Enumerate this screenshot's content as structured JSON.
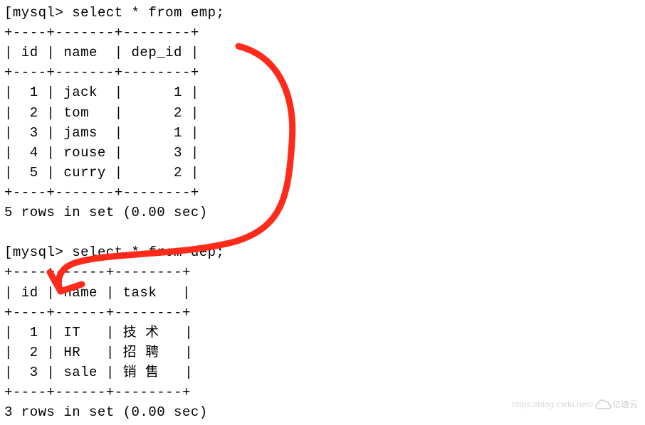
{
  "prompt": "mysql>",
  "query1": {
    "command": "select * from emp;",
    "border_top": "+----+-------+--------+",
    "header_row": "| id | name  | dep_id |",
    "border_mid": "+----+-------+--------+",
    "columns": [
      "id",
      "name",
      "dep_id"
    ],
    "rows": [
      {
        "line": "|  1 | jack  |      1 |",
        "id": 1,
        "name": "jack",
        "dep_id": 1
      },
      {
        "line": "|  2 | tom   |      2 |",
        "id": 2,
        "name": "tom",
        "dep_id": 2
      },
      {
        "line": "|  3 | jams  |      1 |",
        "id": 3,
        "name": "jams",
        "dep_id": 1
      },
      {
        "line": "|  4 | rouse |      3 |",
        "id": 4,
        "name": "rouse",
        "dep_id": 3
      },
      {
        "line": "|  5 | curry |      2 |",
        "id": 5,
        "name": "curry",
        "dep_id": 2
      }
    ],
    "border_bot": "+----+-------+--------+",
    "status": "5 rows in set (0.00 sec)"
  },
  "query2": {
    "command": "select * from dep;",
    "border_top": "+----+------+--------+",
    "header_row": "| id | name | task   |",
    "border_mid": "+----+------+--------+",
    "columns": [
      "id",
      "name",
      "task"
    ],
    "rows": [
      {
        "line": "|  1 | IT   | 技 术   |",
        "id": 1,
        "name": "IT",
        "task": "技术"
      },
      {
        "line": "|  2 | HR   | 招 聘   |",
        "id": 2,
        "name": "HR",
        "task": "招聘"
      },
      {
        "line": "|  3 | sale | 销 售   |",
        "id": 3,
        "name": "sale",
        "task": "销售"
      }
    ],
    "border_bot": "+----+------+--------+",
    "status": "3 rows in set (0.00 sec)"
  },
  "annotation": {
    "color": "#ff2a1a",
    "description": "hand-drawn-arrow-linking-emp-dep_id-to-dep-id"
  },
  "watermark": {
    "text": "https://blog.csdn.net/r",
    "brand": "亿速云"
  }
}
